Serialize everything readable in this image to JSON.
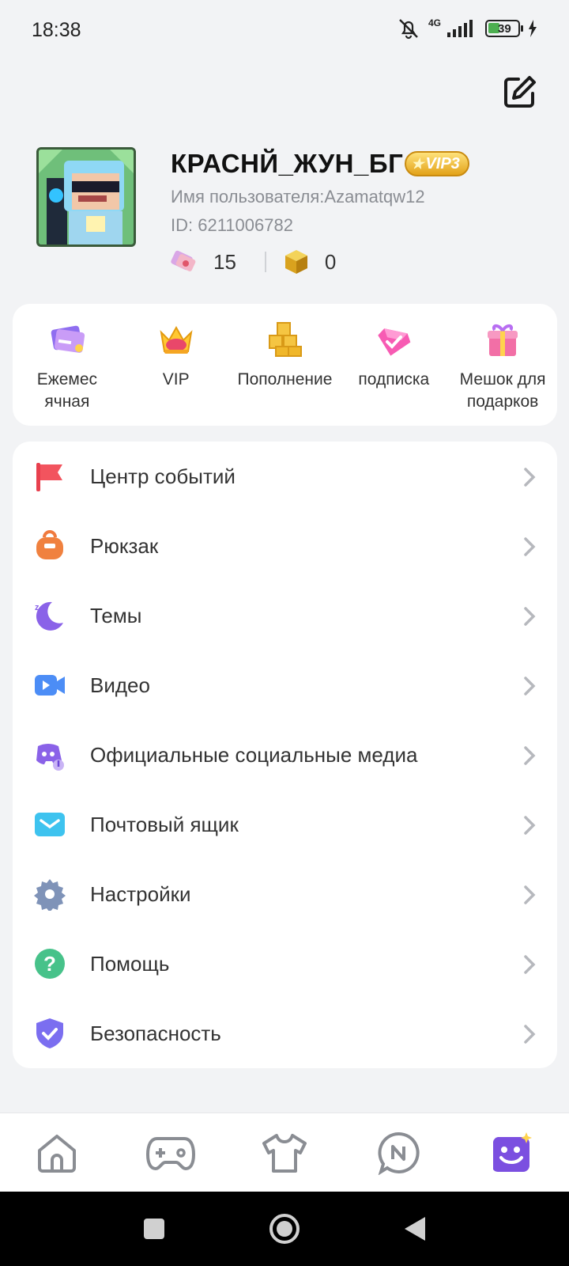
{
  "status_bar": {
    "time": "18:38",
    "network": "4G",
    "battery": "39"
  },
  "profile": {
    "nickname": "КРАСНЙ_ЖУН_БГ",
    "vip_badge": "VIP3",
    "username": "Имя пользователя:Azamatqw12",
    "user_id": "ID: 6211006782",
    "tickets": "15",
    "cubes": "0"
  },
  "quick_actions": [
    {
      "label": "Ежемес\nячная",
      "icon": "monthly-card-icon"
    },
    {
      "label": "VIP",
      "icon": "crown-icon"
    },
    {
      "label": "Пополнение",
      "icon": "gold-cubes-icon"
    },
    {
      "label": "подписка",
      "icon": "diamond-icon"
    },
    {
      "label": "Мешок для подарков",
      "icon": "gift-box-icon"
    }
  ],
  "menu": [
    {
      "label": "Центр событий",
      "icon": "flag-icon"
    },
    {
      "label": "Рюкзак",
      "icon": "backpack-icon"
    },
    {
      "label": "Темы",
      "icon": "moon-icon"
    },
    {
      "label": "Видео",
      "icon": "video-camera-icon"
    },
    {
      "label": "Официальные социальные медиа",
      "icon": "social-media-icon"
    },
    {
      "label": "Почтовый ящик",
      "icon": "mailbox-icon"
    },
    {
      "label": "Настройки",
      "icon": "gear-icon"
    },
    {
      "label": "Помощь",
      "icon": "help-icon"
    },
    {
      "label": "Безопасность",
      "icon": "shield-icon"
    }
  ],
  "bottom_nav": [
    {
      "name": "home",
      "icon": "home-icon"
    },
    {
      "name": "games",
      "icon": "gamepad-icon"
    },
    {
      "name": "wardrobe",
      "icon": "tshirt-icon"
    },
    {
      "name": "news",
      "icon": "news-bubble-icon"
    },
    {
      "name": "profile",
      "icon": "smiley-profile-icon",
      "active": true
    }
  ],
  "colors": {
    "accent": "#7b4fe0",
    "background": "#f2f3f5",
    "card": "#ffffff",
    "vip_gold": "#e3a21a"
  }
}
